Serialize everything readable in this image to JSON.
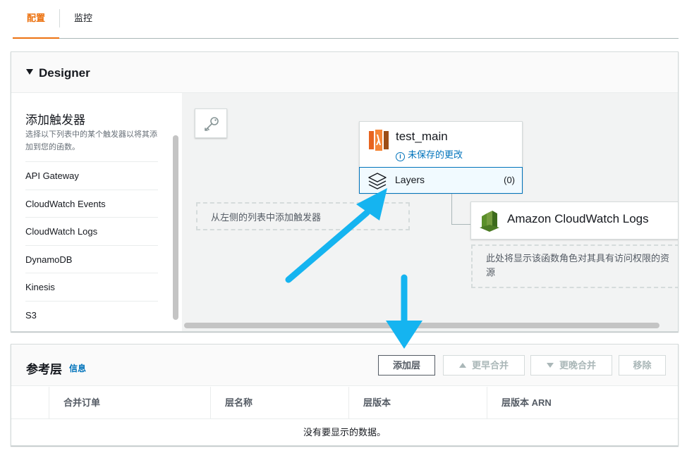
{
  "tabs": {
    "config": "配置",
    "monitor": "监控"
  },
  "designer": {
    "title": "Designer",
    "trigger_heading": "添加触发器",
    "trigger_desc": "选择以下列表中的某个触发器以将其添加到您的函数。",
    "triggers": [
      "API Gateway",
      "CloudWatch Events",
      "CloudWatch Logs",
      "DynamoDB",
      "Kinesis",
      "S3"
    ],
    "drop_hint": "从左侧的列表中添加触发器",
    "function": {
      "name": "test_main",
      "status": "未保存的更改"
    },
    "layers": {
      "label": "Layers",
      "count": "(0)"
    },
    "resource": {
      "name": "Amazon CloudWatch Logs"
    },
    "permission_hint": "此处将显示该函数角色对其具有访问权限的资源"
  },
  "ref_layers": {
    "title": "参考层",
    "info": "信息",
    "buttons": {
      "add": "添加层",
      "earlier": "更早合并",
      "later": "更晚合并",
      "remove": "移除"
    },
    "columns": [
      "合并订单",
      "层名称",
      "层版本",
      "层版本 ARN"
    ],
    "empty": "没有要显示的数据。"
  },
  "colors": {
    "accent": "#ec7211",
    "link": "#0073bb",
    "annotation_arrow": "#15b4f0"
  },
  "icons": [
    "key-icon",
    "lambda-icon",
    "info-icon",
    "layers-icon",
    "cloudwatch-logs-icon",
    "caret-down-icon"
  ]
}
